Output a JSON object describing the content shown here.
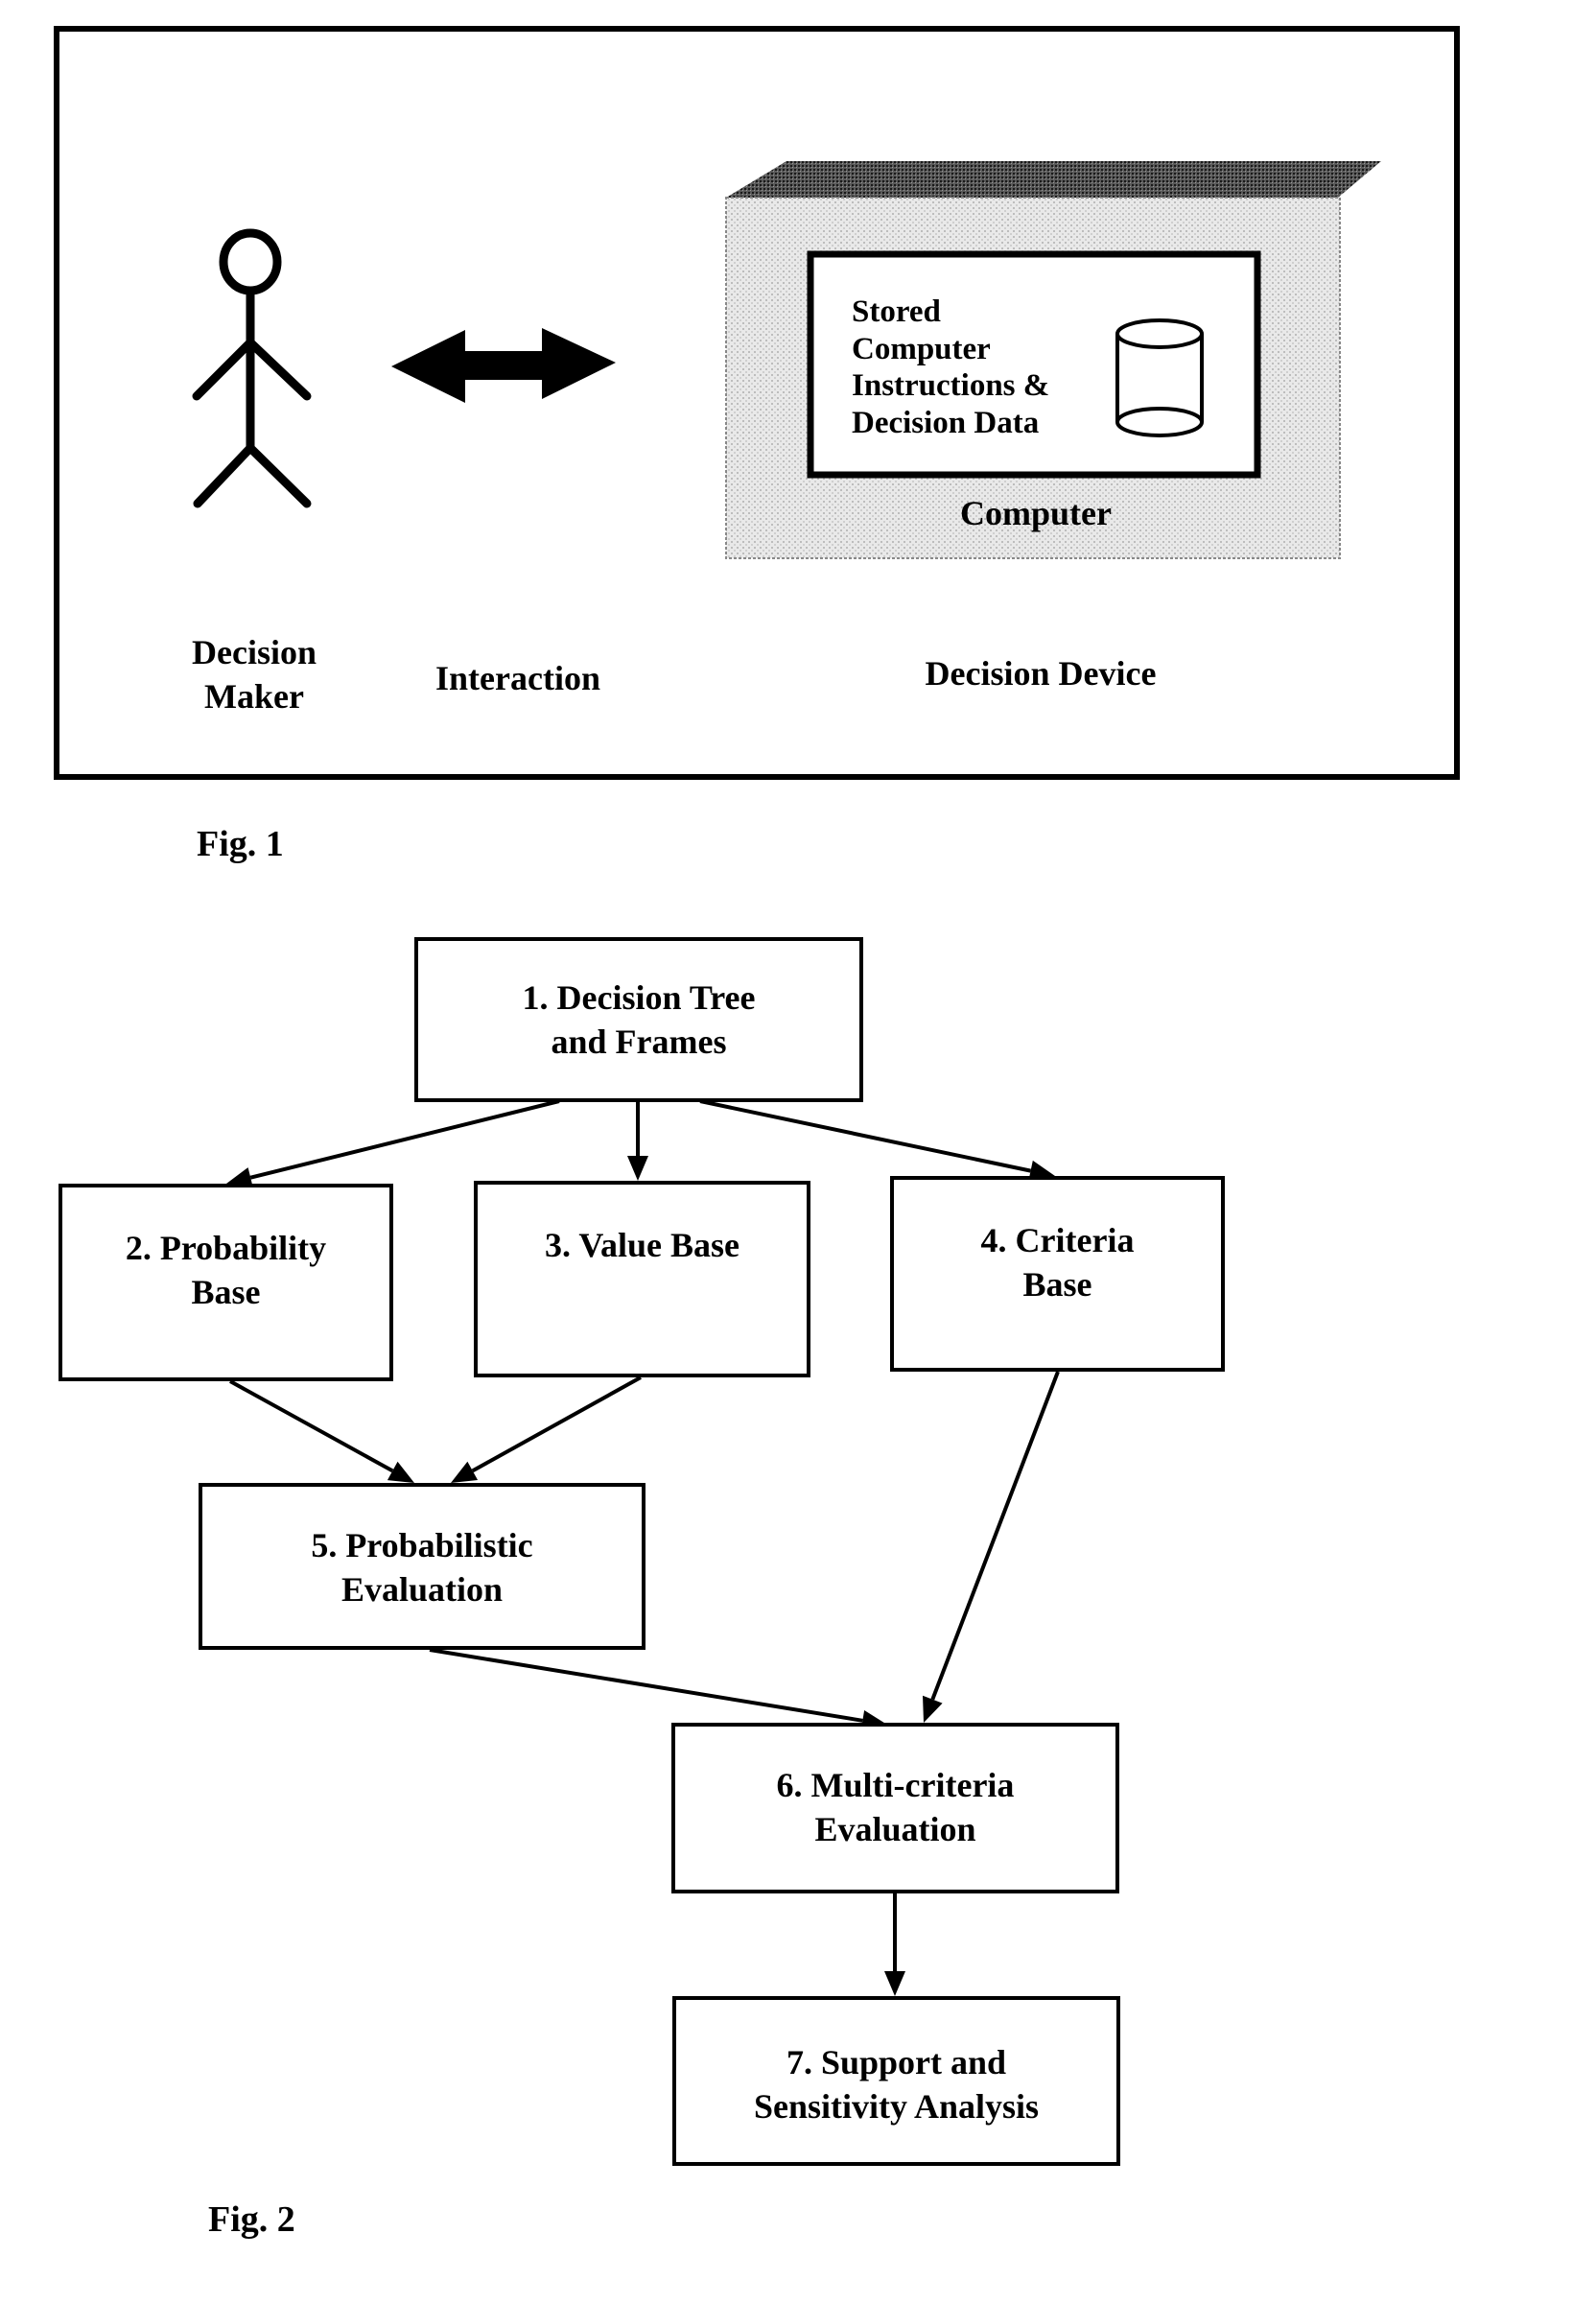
{
  "fig1": {
    "caption": "Fig. 1",
    "decision_maker": {
      "icon": "stick-figure-icon",
      "label_line1": "Decision",
      "label_line2": "Maker"
    },
    "interaction": {
      "icon": "double-arrow-icon",
      "label": "Interaction"
    },
    "decision_device": {
      "label": "Decision Device",
      "computer_label": "Computer",
      "storage": {
        "lines": [
          "Stored",
          "Computer",
          "Instructions &",
          "Decision Data"
        ],
        "icon": "database-cylinder-icon"
      }
    }
  },
  "fig2": {
    "caption": "Fig. 2",
    "nodes": [
      {
        "id": 1,
        "line1": "1. Decision Tree",
        "line2": "and Frames"
      },
      {
        "id": 2,
        "line1": "2. Probability",
        "line2": "Base"
      },
      {
        "id": 3,
        "line1": "3. Value Base",
        "line2": ""
      },
      {
        "id": 4,
        "line1": "4. Criteria",
        "line2": "Base"
      },
      {
        "id": 5,
        "line1": "5. Probabilistic",
        "line2": "Evaluation"
      },
      {
        "id": 6,
        "line1": "6. Multi-criteria",
        "line2": "Evaluation"
      },
      {
        "id": 7,
        "line1": "7. Support and",
        "line2": "Sensitivity Analysis"
      }
    ],
    "edges": [
      {
        "from": 1,
        "to": 2
      },
      {
        "from": 1,
        "to": 3
      },
      {
        "from": 1,
        "to": 4
      },
      {
        "from": 2,
        "to": 5
      },
      {
        "from": 3,
        "to": 5
      },
      {
        "from": 4,
        "to": 6
      },
      {
        "from": 5,
        "to": 6
      },
      {
        "from": 6,
        "to": 7
      }
    ]
  }
}
